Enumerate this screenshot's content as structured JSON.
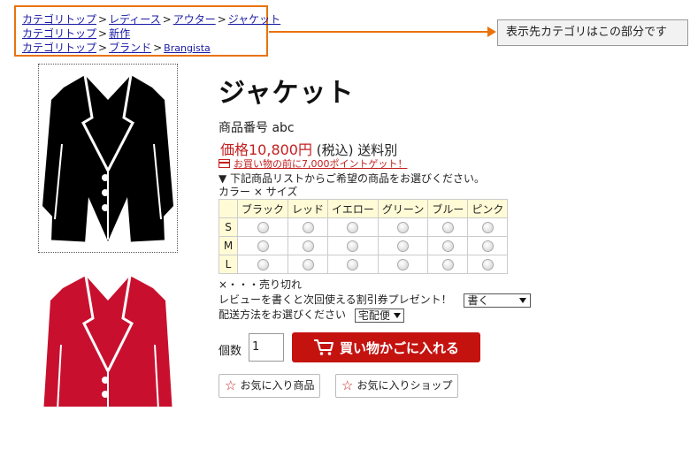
{
  "breadcrumbs": {
    "line1": [
      "カテゴリトップ",
      "レディース",
      "アウター",
      "ジャケット"
    ],
    "line2": [
      "カテゴリトップ",
      "新作"
    ],
    "line3": [
      "カテゴリトップ",
      "ブランド",
      "Brangista"
    ],
    "separator": ">"
  },
  "annotation": {
    "note": "表示先カテゴリはこの部分です"
  },
  "product": {
    "title": "ジャケット",
    "code": "商品番号 abc",
    "price": "価格10,800円",
    "tax": "(税込) 送料別",
    "points_link": "お買い物の前に7,000ポイントゲット！",
    "instruction": "▼ 下記商品リストからご希望の商品をお選びください。",
    "axis_label": "カラー × サイズ"
  },
  "matrix": {
    "colors": [
      "ブラック",
      "レッド",
      "イエロー",
      "グリーン",
      "ブルー",
      "ピンク"
    ],
    "sizes": [
      "S",
      "M",
      "L"
    ]
  },
  "soldout_legend": "×・・・売り切れ",
  "review": {
    "label": "レビューを書くと次回使える割引券プレゼント！",
    "selected": "書く"
  },
  "shipping": {
    "label": "配送方法をお選びください",
    "selected": "宅配便"
  },
  "quantity": {
    "label": "個数",
    "value": "1"
  },
  "cart_button": "買い物かごに入れる",
  "fav_item": "お気に入り商品",
  "fav_shop": "お気に入りショップ",
  "colors": {
    "accent": "#c4130f",
    "annotation": "#e8730c",
    "jacket_black": "#000000",
    "jacket_red": "#c8102e"
  }
}
